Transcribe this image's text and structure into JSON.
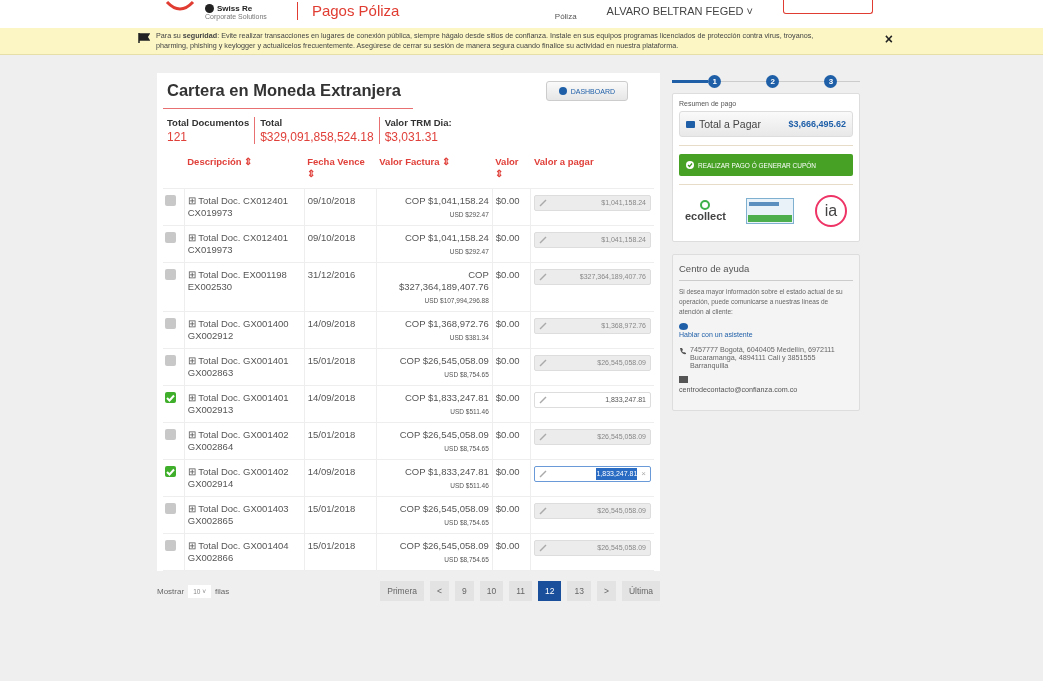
{
  "header": {
    "brand": "Swiss Re",
    "brand_sub": "Corporate Solutions",
    "title": "Pagos Póliza",
    "nav_label": "Póliza",
    "user": "ALVARO BELTRAN FEGED ˅"
  },
  "security_banner": {
    "text": "Para su **seguridad**: Evite realizar transacciones en lugares de conexión pública, siempre hágalo desde sitios de confianza. Instale en sus equipos programas licenciados de protección contra virus, troyanos, pharming, phishing y keylogger y actualícelos frecuentemente. Asegúrese de cerrar su sesión de manera segura cuando finalice su actividad en nuestra plataforma.",
    "close": "×"
  },
  "portfolio": {
    "title": "Cartera en Moneda Extranjera",
    "dashboard_button": "DASHBOARD",
    "summary": [
      {
        "label": "Total Documentos",
        "value": "121"
      },
      {
        "label": "Total",
        "value": "$329,091,858,524.18"
      },
      {
        "label": "Valor TRM Dia:",
        "value": "$3,031.31"
      }
    ],
    "table": {
      "columns": [
        "Descripción ⇕",
        "Fecha Vence ⇕",
        "Valor Factura ⇕",
        "Valor ⇕",
        "Valor a pagar"
      ],
      "rows": [
        {
          "selected": false,
          "description": "⊞ Total Doc. CX012401 CX019973",
          "due": "09/10/2018",
          "cop": "COP $1,041,158.24",
          "usd": "USD $292.47",
          "valor": "$0.00",
          "pay": "$1,041,158.24",
          "focused": false
        },
        {
          "selected": false,
          "description": "⊞ Total Doc. CX012401 CX019973",
          "due": "09/10/2018",
          "cop": "COP $1,041,158.24",
          "usd": "USD $292.47",
          "valor": "$0.00",
          "pay": "$1,041,158.24",
          "focused": false
        },
        {
          "selected": false,
          "description": "⊞ Total Doc. EX001198 EX002530",
          "due": "31/12/2016",
          "cop": "COP $327,364,189,407.76",
          "usd": "USD $107,994,296.88",
          "valor": "$0.00",
          "pay": "$327,364,189,407.76",
          "focused": false
        },
        {
          "selected": false,
          "description": "⊞ Total Doc. GX001400 GX002912",
          "due": "14/09/2018",
          "cop": "COP $1,368,972.76",
          "usd": "USD $381.34",
          "valor": "$0.00",
          "pay": "$1,368,972.76",
          "focused": false
        },
        {
          "selected": false,
          "description": "⊞ Total Doc. GX001401 GX002863",
          "due": "15/01/2018",
          "cop": "COP $26,545,058.09",
          "usd": "USD $8,754.65",
          "valor": "$0.00",
          "pay": "$26,545,058.09",
          "focused": false
        },
        {
          "selected": true,
          "description": "⊞ Total Doc. GX001401 GX002913",
          "due": "14/09/2018",
          "cop": "COP $1,833,247.81",
          "usd": "USD $511.46",
          "valor": "$0.00",
          "pay": "1,833,247.81",
          "focused": false
        },
        {
          "selected": false,
          "description": "⊞ Total Doc. GX001402 GX002864",
          "due": "15/01/2018",
          "cop": "COP $26,545,058.09",
          "usd": "USD $8,754.65",
          "valor": "$0.00",
          "pay": "$26,545,058.09",
          "focused": false
        },
        {
          "selected": true,
          "description": "⊞ Total Doc. GX001402 GX002914",
          "due": "14/09/2018",
          "cop": "COP $1,833,247.81",
          "usd": "USD $511.46",
          "valor": "$0.00",
          "pay": "1,833,247.81",
          "focused": true,
          "clear": "×"
        },
        {
          "selected": false,
          "description": "⊞ Total Doc. GX001403 GX002865",
          "due": "15/01/2018",
          "cop": "COP $26,545,058.09",
          "usd": "USD $8,754.65",
          "valor": "$0.00",
          "pay": "$26,545,058.09",
          "focused": false
        },
        {
          "selected": false,
          "description": "⊞ Total Doc. GX001404 GX002866",
          "due": "15/01/2018",
          "cop": "COP $26,545,058.09",
          "usd": "USD $8,754.65",
          "valor": "$0.00",
          "pay": "$26,545,058.09",
          "focused": false
        }
      ]
    },
    "footer": {
      "show_label": "Mostrar",
      "page_size": "10 ˅",
      "rows_label": "filas",
      "pages": [
        {
          "label": "Primera",
          "selected": false
        },
        {
          "label": "<",
          "selected": false
        },
        {
          "label": "9",
          "selected": false
        },
        {
          "label": "10",
          "selected": false
        },
        {
          "label": "11",
          "selected": false
        },
        {
          "label": "12",
          "selected": true
        },
        {
          "label": "13",
          "selected": false
        },
        {
          "label": ">",
          "selected": false
        },
        {
          "label": "Última",
          "selected": false
        }
      ]
    }
  },
  "stepper": [
    {
      "label": "1",
      "active": true
    },
    {
      "label": "2",
      "active": false
    },
    {
      "label": "3",
      "active": false
    }
  ],
  "payment_summary": {
    "title": "Resumen de pago",
    "total_label": "Total a Pagar",
    "total_value": "$3,666,495.62",
    "pay_button": "REALIZAR PAGO Ó GENERAR CUPÓN",
    "logos": {
      "ecollect": "ecollect",
      "ia": "ia"
    }
  },
  "help": {
    "title": "Centro de ayuda",
    "text": "Si desea mayor información sobre el estado actual de su operación, puede comunicarse a nuestras líneas de atención al cliente:",
    "chat_link": "Hablar con un asistente",
    "phones": "7457777 Bogotá, 6040405 Medellín, 6972111 Bucaramanga, 4894111 Cali y 3851555 Barranquilla",
    "email": "centrodecontacto@confianza.com.co"
  }
}
